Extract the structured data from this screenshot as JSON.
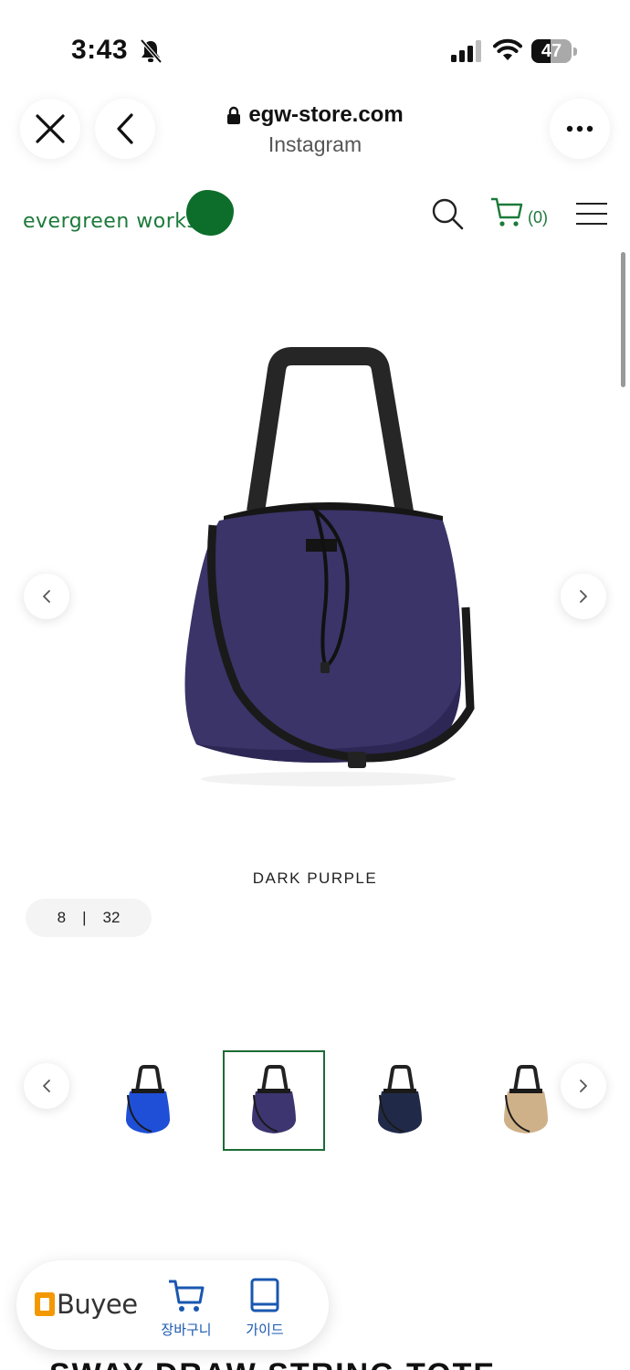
{
  "status_bar": {
    "time": "3:43",
    "battery": "47",
    "battery_level": 0.47
  },
  "browser": {
    "url": "egw-store.com",
    "source": "Instagram"
  },
  "site": {
    "logo_text": "evergreen works",
    "brand_color": "#0d6e2b",
    "cart_count": "(0)"
  },
  "product": {
    "color_name": "DARK PURPLE",
    "pager": {
      "current": "8",
      "separator": "|",
      "total": "32"
    },
    "thumbnails": [
      {
        "color": "#1f4fd6",
        "label": "blue"
      },
      {
        "color": "#3c3570",
        "label": "dark purple",
        "selected": true
      },
      {
        "color": "#202a48",
        "label": "navy"
      },
      {
        "color": "#cfb189",
        "label": "beige"
      }
    ],
    "title_partial": "SWAY DRAW STRING TOTE"
  },
  "buyee": {
    "logo": "Buyee",
    "cart_label": "장바구니",
    "guide_label": "가이드"
  }
}
